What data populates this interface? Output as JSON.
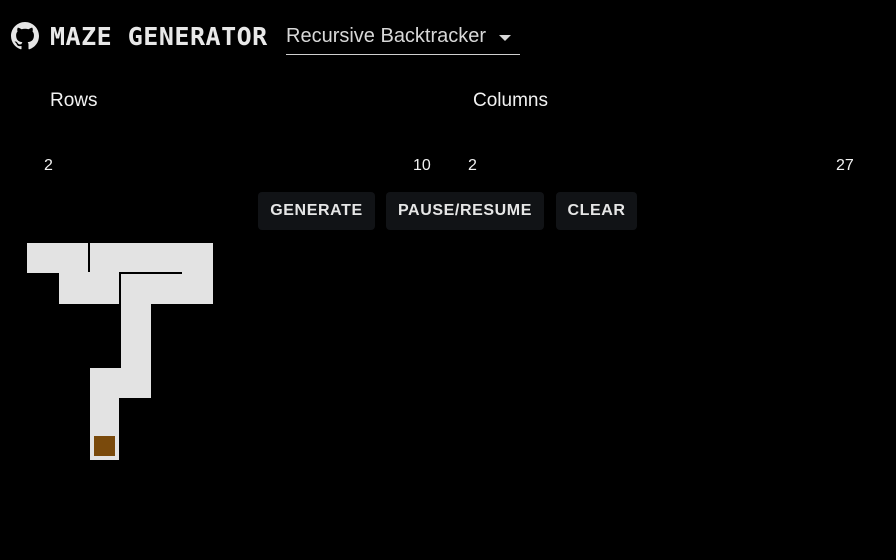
{
  "header": {
    "icon": "github-icon",
    "title": "MAZE GENERATOR",
    "algorithm": {
      "selected": "Recursive Backtracker"
    }
  },
  "rows_slider": {
    "label": "Rows",
    "min": "2",
    "max": "10"
  },
  "columns_slider": {
    "label": "Columns",
    "min": "2",
    "max": "27"
  },
  "buttons": {
    "generate": "GENERATE",
    "pause_resume": "PAUSE/RESUME",
    "clear": "CLEAR"
  },
  "maze": {
    "path_color": "#e3e3e3",
    "current_cell_color": "#7a4a0c",
    "background_color": "#000000"
  }
}
